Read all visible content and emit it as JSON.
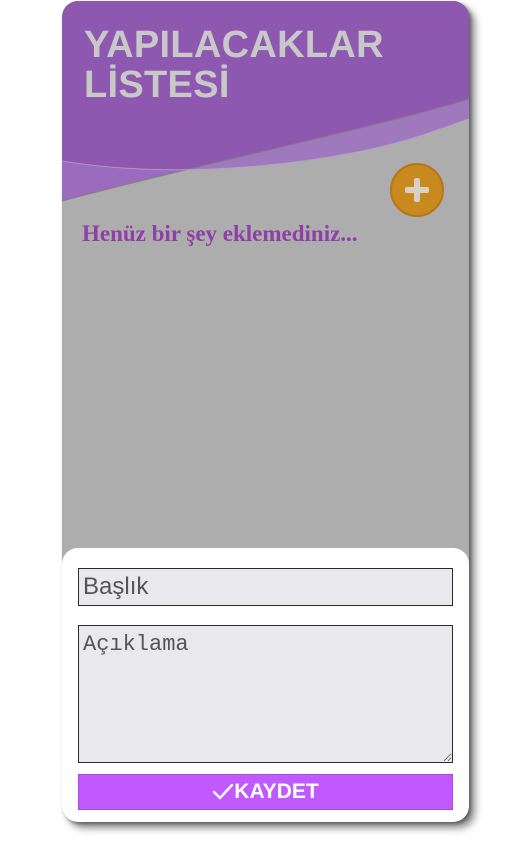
{
  "header": {
    "title": "YAPILACAKLAR\nLİSTESİ"
  },
  "colors": {
    "header_purple": "#8e58b0",
    "background_gray": "#adadad",
    "add_button": "#c8891f",
    "empty_text": "#8e3fa8",
    "save_button": "#c059ff"
  },
  "add_button": {
    "icon": "plus-icon"
  },
  "list": {
    "empty_message": "Henüz bir şey eklemediniz..."
  },
  "form": {
    "title_placeholder": "Başlık",
    "title_value": "",
    "description_placeholder": "Açıklama",
    "description_value": "",
    "save_label": "KAYDET",
    "save_icon": "check-icon"
  }
}
